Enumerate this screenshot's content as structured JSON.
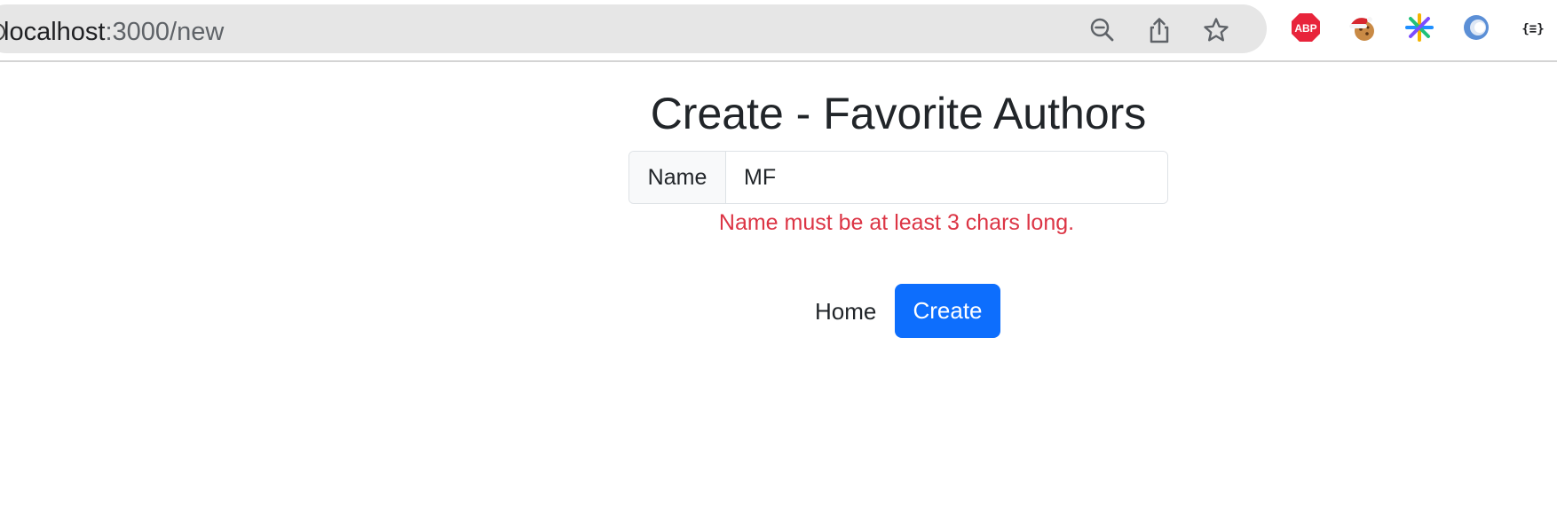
{
  "browser": {
    "url_host": "localhost",
    "url_rest": ":3000/new",
    "icons": [
      "site-info-icon",
      "zoom-out-icon",
      "share-icon",
      "bookmark-star-icon"
    ],
    "extensions": [
      {
        "name": "adblock-plus-icon",
        "label": "ABP",
        "color": "#e8243b"
      },
      {
        "name": "cookie-santa-hat-icon",
        "color": "#d7282f"
      },
      {
        "name": "colorful-asterisk-icon",
        "color": "#1f8fff"
      },
      {
        "name": "circle-ring-icon",
        "color": "#5b8fd6"
      },
      {
        "name": "json-formatter-icon",
        "label": "{≡}",
        "color": "#202124"
      }
    ]
  },
  "page": {
    "title": "Create - Favorite Authors",
    "form": {
      "name_label": "Name",
      "name_value": "MF",
      "error": "Name must be at least 3 chars long."
    },
    "actions": {
      "home_label": "Home",
      "create_label": "Create",
      "create_color": "#0d6efd"
    }
  }
}
